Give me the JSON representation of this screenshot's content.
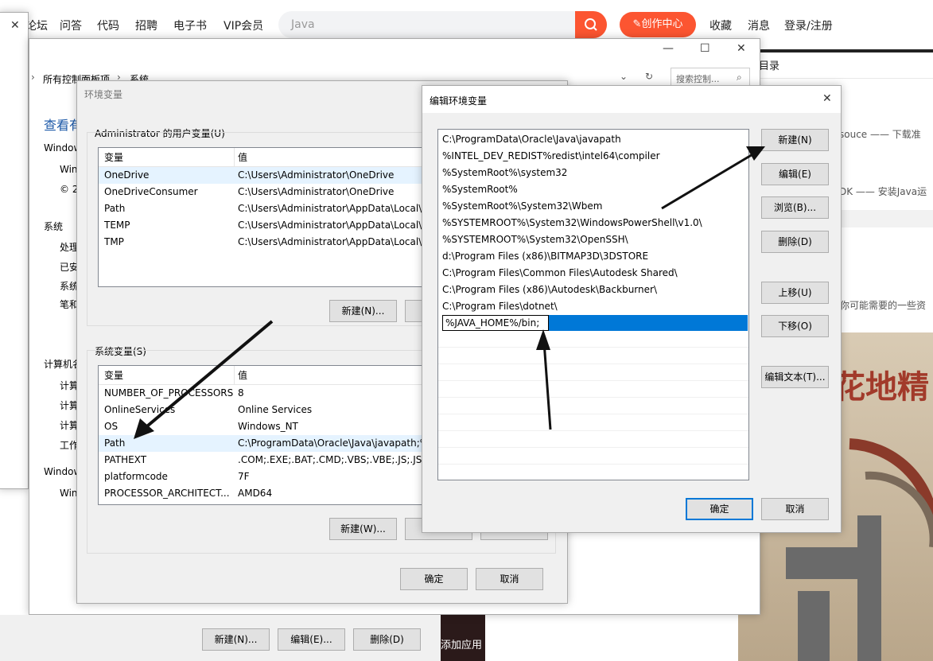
{
  "web": {
    "nav": [
      "论坛",
      "问答",
      "代码",
      "招聘",
      "电子书",
      "VIP会员"
    ],
    "search_placeholder": "Java",
    "create_label": "创作中心",
    "right_nav": [
      "收藏",
      "消息",
      "登录/注册"
    ],
    "side_texts": {
      "toc": "目录",
      "resource": "souce —— 下载准",
      "jdk": "DK —— 安装Java运",
      "maybe": "你可能需要的一些资",
      "art_text": "花地精",
      "add_app": "添加应用"
    }
  },
  "system_window": {
    "breadcrumb": [
      "所有控制面板项",
      "系统"
    ],
    "search_placeholder": "搜索控制...",
    "heading": "查看有",
    "labels": [
      "Window",
      "Win",
      "© 2",
      "系统",
      "处理",
      "已安",
      "系统",
      "笔和",
      "计算机名",
      "计算",
      "计算",
      "计算",
      "工作",
      "Window",
      "Win"
    ],
    "bottom_buttons": [
      "新建(N)...",
      "编辑(E)...",
      "删除(D)"
    ]
  },
  "env_dialog": {
    "title": "环境变量",
    "user_group": "Administrator 的用户变量(U)",
    "columns": [
      "变量",
      "值"
    ],
    "user_vars": [
      [
        "OneDrive",
        "C:\\Users\\Administrator\\OneDrive"
      ],
      [
        "OneDriveConsumer",
        "C:\\Users\\Administrator\\OneDrive"
      ],
      [
        "Path",
        "C:\\Users\\Administrator\\AppData\\Local\\M"
      ],
      [
        "TEMP",
        "C:\\Users\\Administrator\\AppData\\Local\\T"
      ],
      [
        "TMP",
        "C:\\Users\\Administrator\\AppData\\Local\\T"
      ]
    ],
    "user_new": "新建(N)...",
    "system_group": "系统变量(S)",
    "system_vars": [
      [
        "NUMBER_OF_PROCESSORS",
        "8"
      ],
      [
        "OnlineServices",
        "Online Services"
      ],
      [
        "OS",
        "Windows_NT"
      ],
      [
        "Path",
        "C:\\ProgramData\\Oracle\\Java\\javapath;%"
      ],
      [
        "PATHEXT",
        ".COM;.EXE;.BAT;.CMD;.VBS;.VBE;.JS;.JSE;."
      ],
      [
        "platformcode",
        "7F"
      ],
      [
        "PROCESSOR_ARCHITECT...",
        "AMD64"
      ]
    ],
    "system_new": "新建(W)...",
    "ok": "确定",
    "cancel": "取消"
  },
  "edit_dialog": {
    "title": "编辑环境变量",
    "entries": [
      "C:\\ProgramData\\Oracle\\Java\\javapath",
      "%INTEL_DEV_REDIST%redist\\intel64\\compiler",
      "%SystemRoot%\\system32",
      "%SystemRoot%",
      "%SystemRoot%\\System32\\Wbem",
      "%SYSTEMROOT%\\System32\\WindowsPowerShell\\v1.0\\",
      "%SYSTEMROOT%\\System32\\OpenSSH\\",
      "d:\\Program Files (x86)\\BITMAP3D\\3DSTORE",
      "C:\\Program Files\\Common Files\\Autodesk Shared\\",
      "C:\\Program Files (x86)\\Autodesk\\Backburner\\",
      "C:\\Program Files\\dotnet\\"
    ],
    "editing_value": "%JAVA_HOME%/bin;",
    "buttons": {
      "new": "新建(N)",
      "edit": "编辑(E)",
      "browse": "浏览(B)...",
      "delete": "删除(D)",
      "up": "上移(U)",
      "down": "下移(O)",
      "edit_text": "编辑文本(T)..."
    },
    "ok": "确定",
    "cancel": "取消"
  },
  "colors": {
    "accent": "#fc5531",
    "selection": "#0078d7"
  }
}
